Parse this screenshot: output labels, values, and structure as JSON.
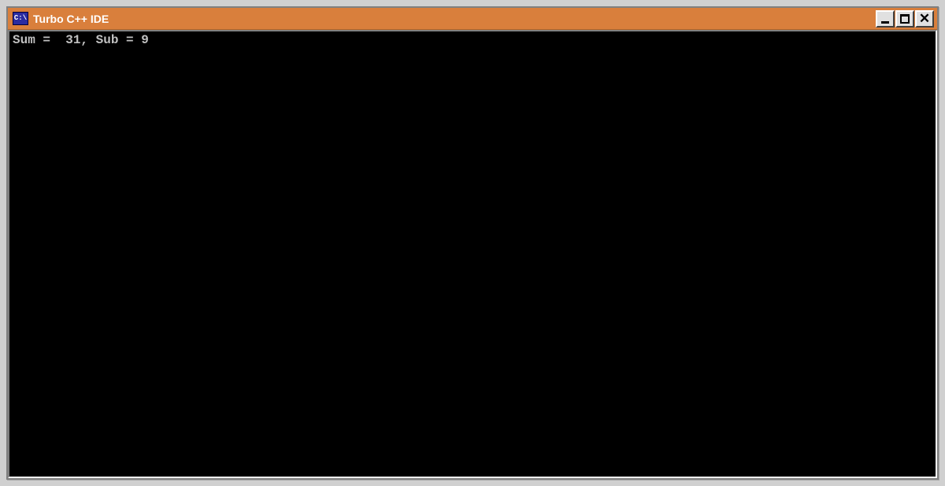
{
  "window": {
    "title": "Turbo C++ IDE",
    "app_icon_label": "C:\\"
  },
  "console": {
    "output": "Sum =  31, Sub = 9"
  },
  "controls": {
    "minimize_symbol": "minimize",
    "maximize_symbol": "maximize",
    "close_symbol": "✕"
  }
}
